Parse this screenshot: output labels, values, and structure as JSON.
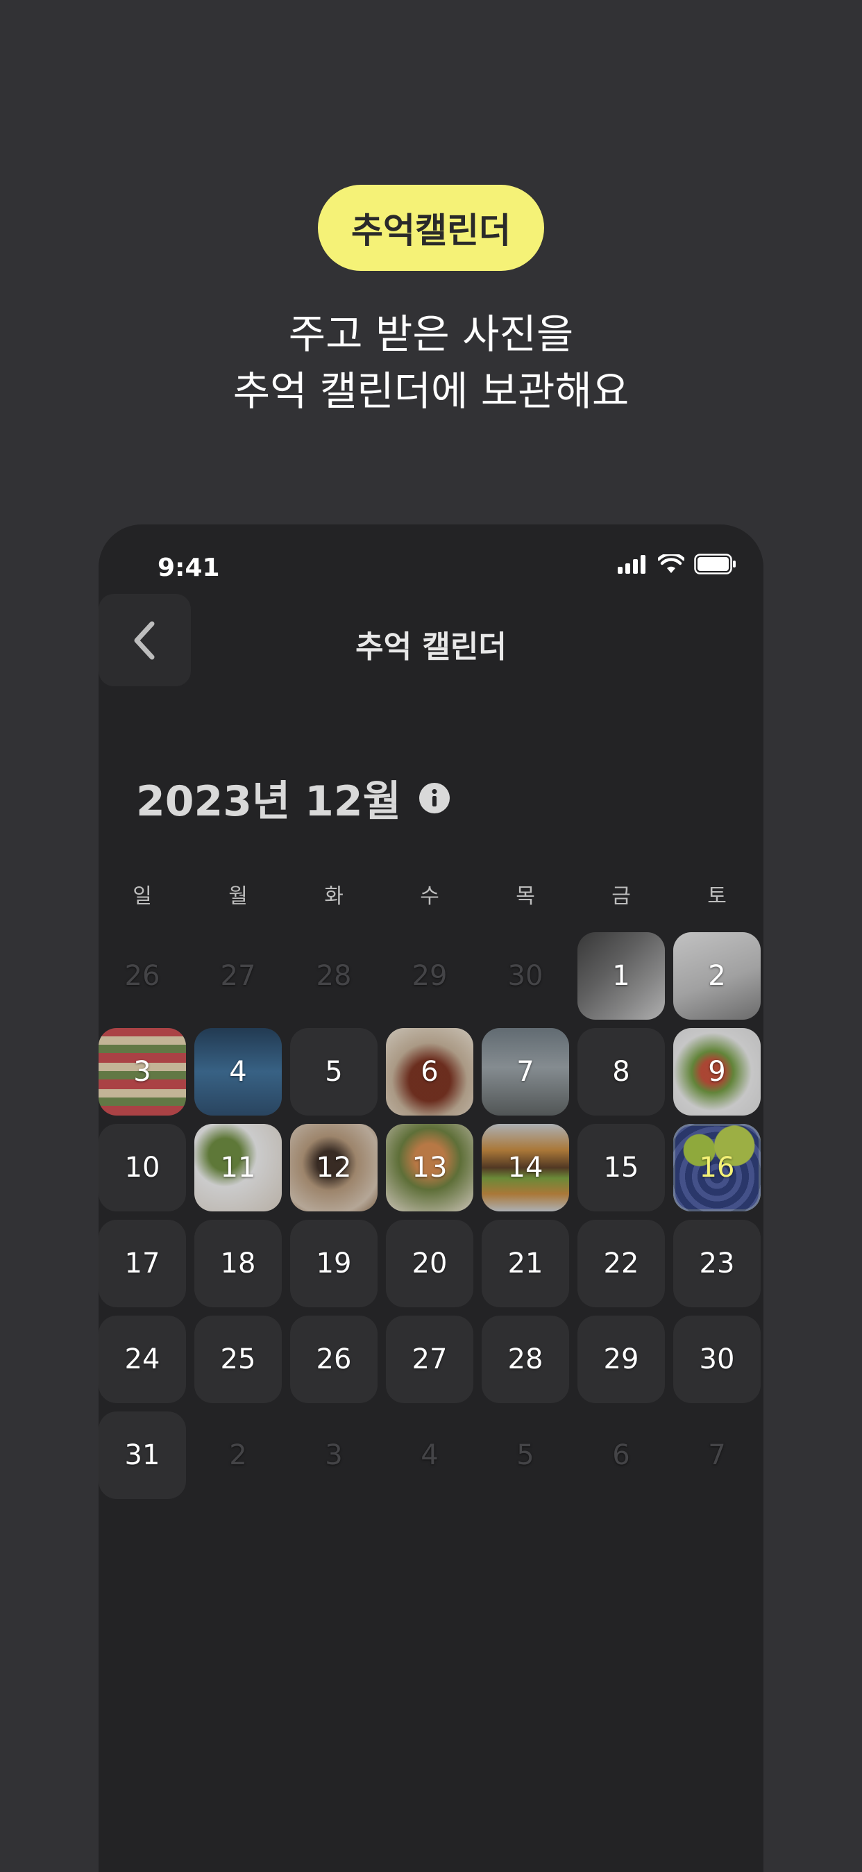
{
  "badge": "추억캘린더",
  "headline": {
    "line1": "주고 받은 사진을",
    "line2": "추억 캘린더에 보관해요"
  },
  "status": {
    "time": "9:41"
  },
  "nav": {
    "title": "추억 캘린더",
    "back_icon": "chevron-left-icon"
  },
  "month": {
    "title": "2023년 12월",
    "info_icon": "info-icon"
  },
  "weekdays": [
    "일",
    "월",
    "화",
    "수",
    "목",
    "금",
    "토"
  ],
  "days": [
    {
      "label": "26",
      "state": "out"
    },
    {
      "label": "27",
      "state": "out"
    },
    {
      "label": "28",
      "state": "out"
    },
    {
      "label": "29",
      "state": "out"
    },
    {
      "label": "30",
      "state": "out"
    },
    {
      "label": "1",
      "state": "photo",
      "photo": "cat"
    },
    {
      "label": "2",
      "state": "photo",
      "photo": "mug"
    },
    {
      "label": "3",
      "state": "photo",
      "photo": "market"
    },
    {
      "label": "4",
      "state": "photo",
      "photo": "bus"
    },
    {
      "label": "5",
      "state": "cur"
    },
    {
      "label": "6",
      "state": "photo",
      "photo": "drink"
    },
    {
      "label": "7",
      "state": "photo",
      "photo": "bike"
    },
    {
      "label": "8",
      "state": "cur"
    },
    {
      "label": "9",
      "state": "photo",
      "photo": "salad"
    },
    {
      "label": "10",
      "state": "cur"
    },
    {
      "label": "11",
      "state": "photo",
      "photo": "table"
    },
    {
      "label": "12",
      "state": "photo",
      "photo": "siamese"
    },
    {
      "label": "13",
      "state": "photo",
      "photo": "meal"
    },
    {
      "label": "14",
      "state": "photo",
      "photo": "burger"
    },
    {
      "label": "15",
      "state": "cur"
    },
    {
      "label": "16",
      "state": "selected",
      "photo": "berries"
    },
    {
      "label": "17",
      "state": "cur"
    },
    {
      "label": "18",
      "state": "cur"
    },
    {
      "label": "19",
      "state": "cur"
    },
    {
      "label": "20",
      "state": "cur"
    },
    {
      "label": "21",
      "state": "cur"
    },
    {
      "label": "22",
      "state": "cur"
    },
    {
      "label": "23",
      "state": "cur"
    },
    {
      "label": "24",
      "state": "cur"
    },
    {
      "label": "25",
      "state": "cur"
    },
    {
      "label": "26",
      "state": "cur"
    },
    {
      "label": "27",
      "state": "cur"
    },
    {
      "label": "28",
      "state": "cur"
    },
    {
      "label": "29",
      "state": "cur"
    },
    {
      "label": "30",
      "state": "cur"
    },
    {
      "label": "31",
      "state": "cur"
    },
    {
      "label": "2",
      "state": "out"
    },
    {
      "label": "3",
      "state": "out"
    },
    {
      "label": "4",
      "state": "out"
    },
    {
      "label": "5",
      "state": "out"
    },
    {
      "label": "6",
      "state": "out"
    },
    {
      "label": "7",
      "state": "out"
    }
  ],
  "colors": {
    "accent": "#F5F277",
    "page_bg": "#323235",
    "phone_bg": "#232325",
    "cell_bg": "#2F2F31"
  }
}
